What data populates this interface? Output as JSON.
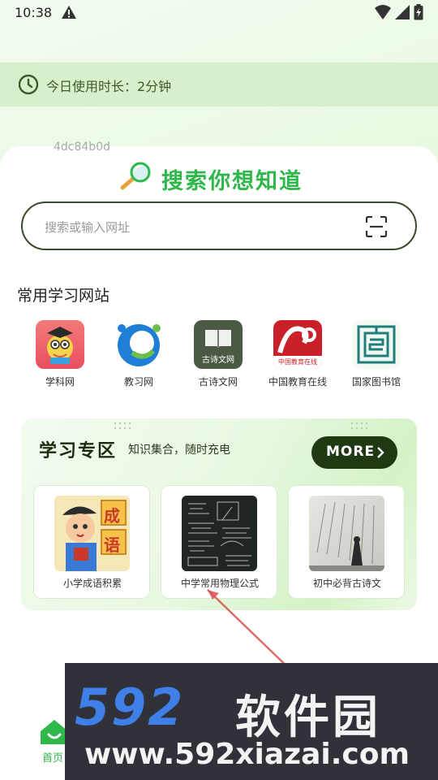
{
  "status_bar": {
    "time": "10:38"
  },
  "usage": {
    "text": "今日使用时长：2分钟"
  },
  "watermark_id": "4dc84b0d",
  "search": {
    "heading": "搜索你想知道",
    "placeholder": "搜索或输入网址"
  },
  "sites_section": {
    "title": "常用学习网站",
    "items": [
      {
        "label": "学科网",
        "icon": "xuekewang-logo"
      },
      {
        "label": "教习网",
        "icon": "jiaoxiwang-logo"
      },
      {
        "label": "古诗文网",
        "icon": "gushiwen-logo",
        "icon_text": "古诗文网"
      },
      {
        "label": "中国教育在线",
        "icon": "eol-logo",
        "icon_text": "中国教育在线"
      },
      {
        "label": "国家图书馆",
        "icon": "nlc-logo"
      }
    ]
  },
  "study_zone": {
    "title": "学习专区",
    "subtitle": "知识集合，随时充电",
    "more_label": "MORE",
    "cards": [
      {
        "label": "小学成语积累",
        "thumb": "idiom-cartoon",
        "thumb_chars": [
          "成",
          "语"
        ]
      },
      {
        "label": "中学常用物理公式",
        "thumb": "physics-blackboard"
      },
      {
        "label": "初中必背古诗文",
        "thumb": "ink-painting"
      }
    ]
  },
  "bottom_nav": {
    "home_label": "首页"
  },
  "banner_watermark": {
    "brand_num": "592",
    "brand_cn": "软件园",
    "url": "www.592xiazai.com"
  },
  "colors": {
    "accent_green": "#2fb84a",
    "dark_green": "#1f3a12",
    "watermark_bg": "#31313a",
    "watermark_blue": "#3f7fe8"
  }
}
